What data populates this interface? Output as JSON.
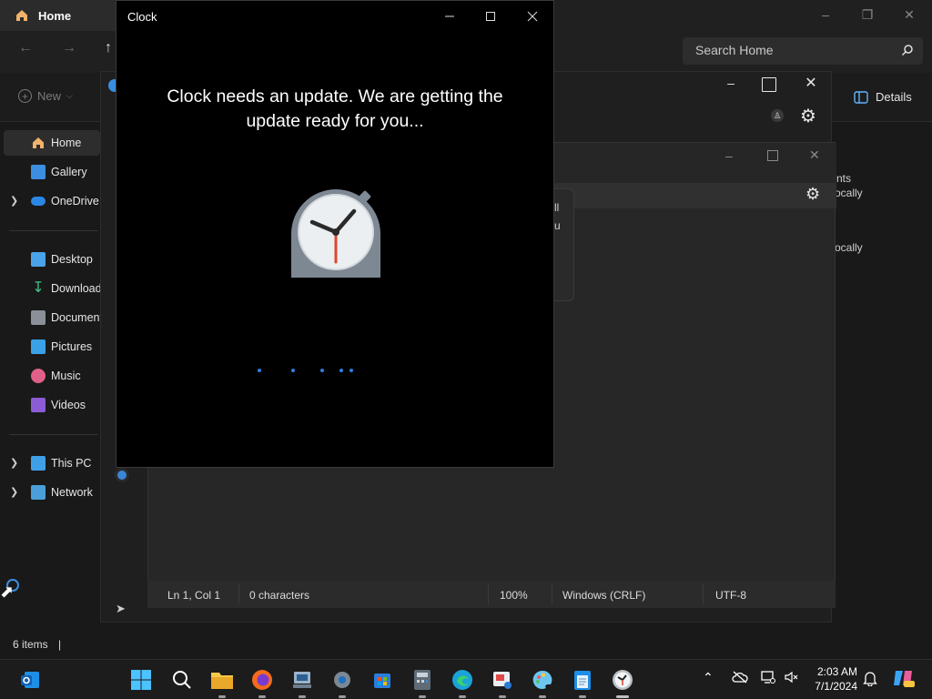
{
  "explorer": {
    "tab_title": "Home",
    "search_placeholder": "Search Home",
    "new_label": "New",
    "details_label": "Details",
    "sidebar": {
      "items": [
        {
          "label": "Home"
        },
        {
          "label": "Gallery"
        },
        {
          "label": "OneDrive"
        },
        {
          "label": "Desktop"
        },
        {
          "label": "Downloads"
        },
        {
          "label": "Documents"
        },
        {
          "label": "Pictures"
        },
        {
          "label": "Music"
        },
        {
          "label": "Videos"
        },
        {
          "label": "This PC"
        },
        {
          "label": "Network"
        }
      ]
    },
    "status_items": "6 items"
  },
  "background_text": {
    "ents": "nts",
    "locally1": "ocally",
    "locally2": "ocally",
    "frag1": "ll",
    "frag2": "u"
  },
  "editor_status": {
    "position": "Ln 1, Col 1",
    "characters": "0 characters",
    "zoom": "100%",
    "line_ending": "Windows (CRLF)",
    "encoding": "UTF-8"
  },
  "clock_window": {
    "title": "Clock",
    "message": "Clock needs an update. We are getting the update ready for you...",
    "accent_color": "#2f7de0"
  },
  "taskbar": {
    "time": "2:03 AM",
    "date": "7/1/2024",
    "apps": [
      "outlook",
      "start",
      "search",
      "file-explorer",
      "firefox",
      "network-tool",
      "settings",
      "microsoft-store",
      "calculator",
      "edge",
      "snipping-tool",
      "paint",
      "notepad",
      "clock"
    ]
  }
}
